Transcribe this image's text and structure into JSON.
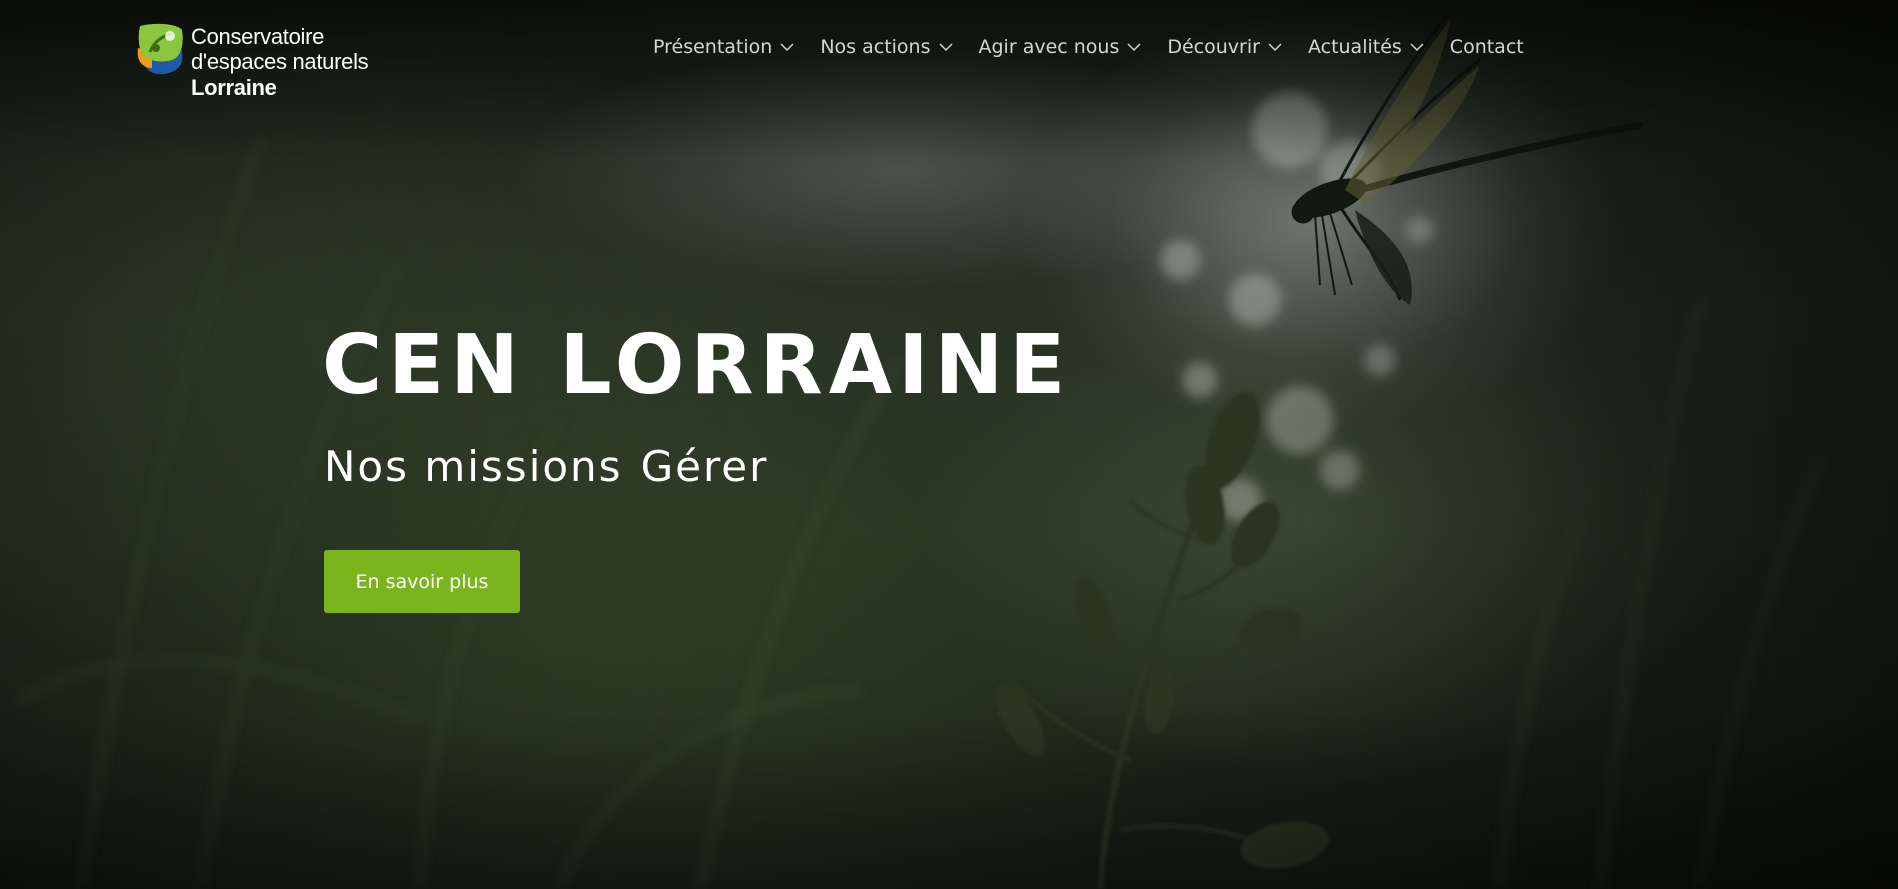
{
  "header": {
    "logo": {
      "line1": "Conservatoire",
      "line2": "d'espaces naturels",
      "line3": "Lorraine"
    },
    "nav": [
      {
        "label": "Présentation",
        "dropdown": true
      },
      {
        "label": "Nos actions",
        "dropdown": true
      },
      {
        "label": "Agir avec nous",
        "dropdown": true
      },
      {
        "label": "Découvrir",
        "dropdown": true
      },
      {
        "label": "Actualités",
        "dropdown": true
      },
      {
        "label": "Contact",
        "dropdown": false
      }
    ]
  },
  "hero": {
    "title": "CEN LORRAINE",
    "subtitle_part1": "Nos missions",
    "subtitle_part2": "Gérer",
    "cta_label": "En savoir plus",
    "background_image": "dragonfly-over-grass-photo"
  },
  "colors": {
    "accent": "#7ab51d",
    "logo_green": "#8cc63f",
    "logo_blue": "#1f5aa8",
    "logo_orange": "#f39a1e",
    "text": "#ffffff"
  },
  "icons": {
    "nav_dropdown": "chevron-down-icon"
  }
}
